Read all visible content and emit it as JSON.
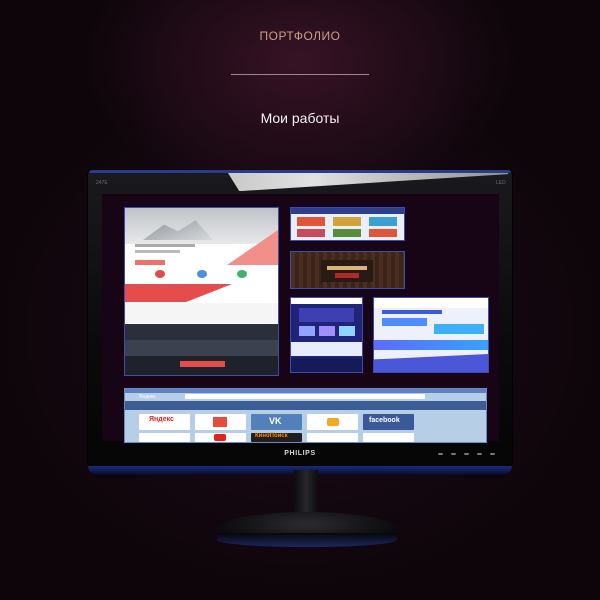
{
  "page": {
    "section_label": "ПОРТФОЛИО",
    "heading": "Мои работы"
  },
  "monitor": {
    "brand": "PHILIPS",
    "bezel_left_mark": "247E",
    "bezel_right_mark": "LED"
  },
  "portfolio": {
    "yandex_logo": "Яндекс",
    "tiles": [
      "Яндекс",
      "",
      "VK",
      "",
      "facebook"
    ],
    "tiles_row2": [
      "",
      "",
      "КиноПоиск",
      "",
      ""
    ]
  },
  "colors": {
    "accent_blue": "#2a3b8f",
    "label": "#c9a08c"
  }
}
